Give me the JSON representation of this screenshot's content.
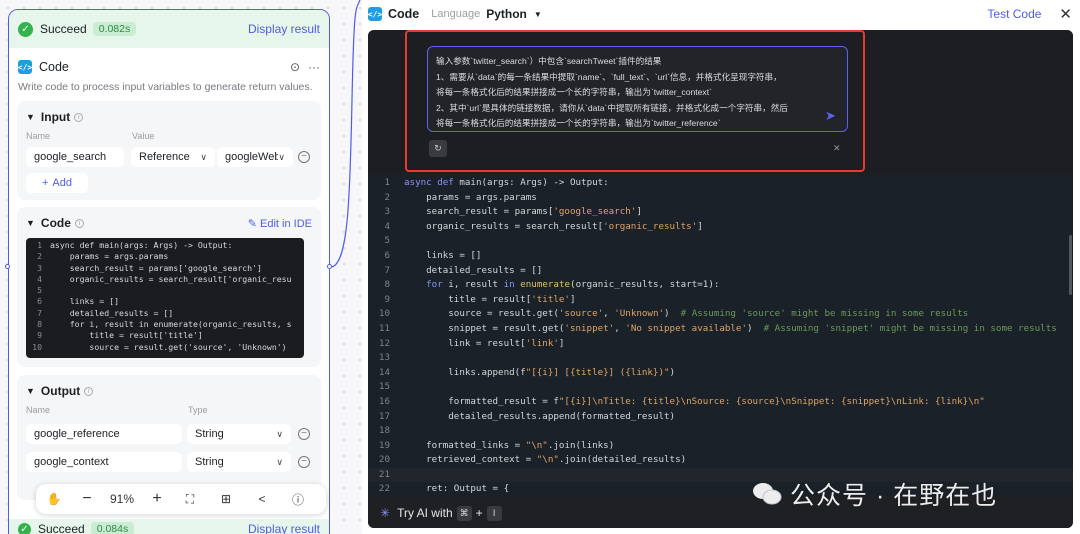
{
  "left": {
    "status": {
      "label": "Succeed",
      "time": "0.082s",
      "link": "Display result"
    },
    "node": {
      "title": "Code",
      "description": "Write code to process input variables to generate return values."
    },
    "input": {
      "title": "Input",
      "name_label": "Name",
      "value_label": "Value",
      "row": {
        "name": "google_search",
        "ref_type": "Reference",
        "ref_value": "googleWebS"
      },
      "add_label": "Add"
    },
    "code": {
      "title": "Code",
      "edit_label": "Edit in IDE",
      "lines": [
        {
          "n": "1",
          "t": "async def main(args: Args) -> Output:"
        },
        {
          "n": "2",
          "t": "    params = args.params"
        },
        {
          "n": "3",
          "t": "    search_result = params['google_search']"
        },
        {
          "n": "4",
          "t": "    organic_results = search_result['organic_resu"
        },
        {
          "n": "5",
          "t": ""
        },
        {
          "n": "6",
          "t": "    links = []"
        },
        {
          "n": "7",
          "t": "    detailed_results = []"
        },
        {
          "n": "8",
          "t": "    for i, result in enumerate(organic_results, s"
        },
        {
          "n": "9",
          "t": "        title = result['title']"
        },
        {
          "n": "10",
          "t": "        source = result.get('source', 'Unknown')"
        }
      ]
    },
    "output": {
      "title": "Output",
      "name_label": "Name",
      "type_label": "Type",
      "rows": [
        {
          "name": "google_reference",
          "type": "String"
        },
        {
          "name": "google_context",
          "type": "String"
        }
      ]
    },
    "toolbar": {
      "zoom": "91%"
    },
    "bottom_status": {
      "label": "Succeed",
      "time": "0.084s",
      "link": "Display result"
    }
  },
  "panel": {
    "title": "Code",
    "language_label": "Language",
    "language_value": "Python",
    "test_label": "Test Code",
    "ai_prompt_lines": [
      "输入参数`twitter_search`）中包含`searchTweet`插件的结果",
      "1、需要从`data`的每一条结果中提取`name`、`full_text`、`url`信息，并格式化呈现字符串，",
      "将每一条格式化后的结果拼接成一个长的字符串，输出为`twitter_context`",
      "2、其中`url`是具体的链接数据，请你从`data`中提取所有链接，并格式化成一个字符串，然后",
      "将每一条格式化后的结果拼接成一个长的字符串，输出为`twitter_reference`"
    ],
    "code_lines": [
      "async def main(args: Args) -> Output:",
      "    params = args.params",
      "    search_result = params['google_search']",
      "    organic_results = search_result['organic_results']",
      "",
      "    links = []",
      "    detailed_results = []",
      "    for i, result in enumerate(organic_results, start=1):",
      "        title = result['title']",
      "        source = result.get('source', 'Unknown')  # Assuming 'source' might be missing in some results",
      "        snippet = result.get('snippet', 'No snippet available')  # Assuming 'snippet' might be missing in some results",
      "        link = result['link']",
      "",
      "        links.append(f\"[{i}] [{title}] ({link})\")",
      "",
      "        formatted_result = f\"[{i}]\\nTitle: {title}\\nSource: {source}\\nSnippet: {snippet}\\nLink: {link}\\n\"",
      "        detailed_results.append(formatted_result)",
      "",
      "    formatted_links = \"\\n\".join(links)",
      "    retrieved_context = \"\\n\".join(detailed_results)",
      "",
      "    ret: Output = {"
    ],
    "ai_footer": {
      "label": "Try AI with",
      "key1": "⌘",
      "plus": "+",
      "key2": "I"
    }
  },
  "watermark": "公众号 · 在野在也",
  "colors": {
    "accent": "#4e5ce8",
    "success": "#33b24d",
    "highlight_border": "#e53c2f"
  }
}
